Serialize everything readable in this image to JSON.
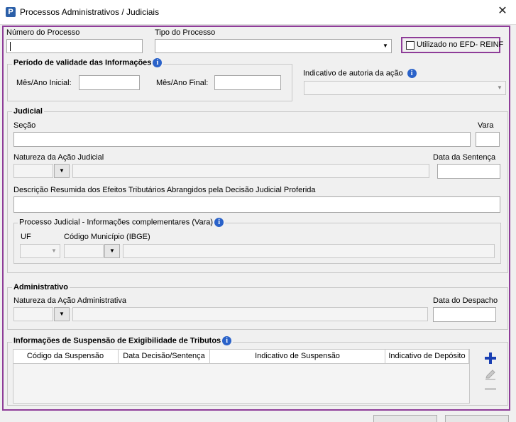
{
  "window": {
    "title": "Processos Administrativos / Judiciais",
    "app_icon": "P",
    "close": "✕"
  },
  "top": {
    "numero_label": "Número do Processo",
    "numero_value": "",
    "tipo_label": "Tipo do Processo",
    "tipo_value": "",
    "efd_label": "Utilizado no EFD- REINF",
    "efd_checked": false
  },
  "periodo": {
    "legend": "Período de validade das Informações",
    "inicial_label": "Mês/Ano Inicial:",
    "inicial_value": "",
    "final_label": "Mês/Ano Final:",
    "final_value": ""
  },
  "autoria": {
    "label": "Indicativo de autoria da ação",
    "value": ""
  },
  "judicial": {
    "legend": "Judicial",
    "secao_label": "Seção",
    "vara_label": "Vara",
    "natureza_label": "Natureza da Ação Judicial",
    "data_sentenca_label": "Data da Sentença",
    "descricao_label": "Descrição Resumida dos Efeitos Tributários Abrangidos pela Decisão Judicial Proferida",
    "complementares": {
      "legend": "Processo Judicial - Informações complementares (Vara)",
      "uf_label": "UF",
      "municipio_label": "Código Município (IBGE)"
    }
  },
  "administrativo": {
    "legend": "Administrativo",
    "natureza_label": "Natureza da Ação Administrativa",
    "data_despacho_label": "Data do Despacho"
  },
  "suspensao": {
    "legend": "Informações de Suspensão de Exigibilidade de Tributos",
    "columns": [
      "Código da Suspensão",
      "Data Decisão/Sentença",
      "Indicativo de Suspensão",
      "Indicativo de Depósito"
    ],
    "rows": []
  },
  "icons": {
    "add": "plus-icon",
    "edit": "pencil-icon",
    "remove": "minus-icon",
    "info": "info-icon"
  },
  "colors": {
    "highlight": "#8e3c98",
    "info": "#2a62c9",
    "add": "#1a3fb3"
  }
}
